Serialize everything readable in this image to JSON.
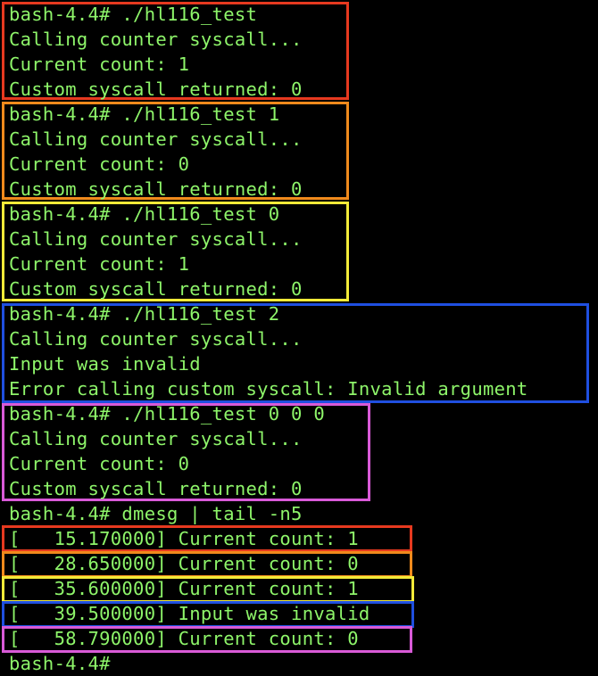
{
  "colors": {
    "text": "#8ef56a",
    "background": "#000000",
    "red": "#e6391f",
    "orange": "#f08a1c",
    "yellow": "#f2ea38",
    "blue": "#1f4fe0",
    "magenta": "#d95ad8"
  },
  "terminal": {
    "lines": [
      "bash-4.4# ./hl116_test",
      "Calling counter syscall...",
      "Current count: 1",
      "Custom syscall returned: 0",
      "bash-4.4# ./hl116_test 1",
      "Calling counter syscall...",
      "Current count: 0",
      "Custom syscall returned: 0",
      "bash-4.4# ./hl116_test 0",
      "Calling counter syscall...",
      "Current count: 1",
      "Custom syscall returned: 0",
      "bash-4.4# ./hl116_test 2",
      "Calling counter syscall...",
      "Input was invalid",
      "Error calling custom syscall: Invalid argument",
      "bash-4.4# ./hl116_test 0 0 0",
      "Calling counter syscall...",
      "Current count: 0",
      "Custom syscall returned: 0",
      "bash-4.4# dmesg | tail -n5",
      "[   15.170000] Current count: 1",
      "[   28.650000] Current count: 0",
      "[   35.600000] Current count: 1",
      "[   39.500000] Input was invalid",
      "[   58.790000] Current count: 0",
      "bash-4.4#"
    ]
  }
}
